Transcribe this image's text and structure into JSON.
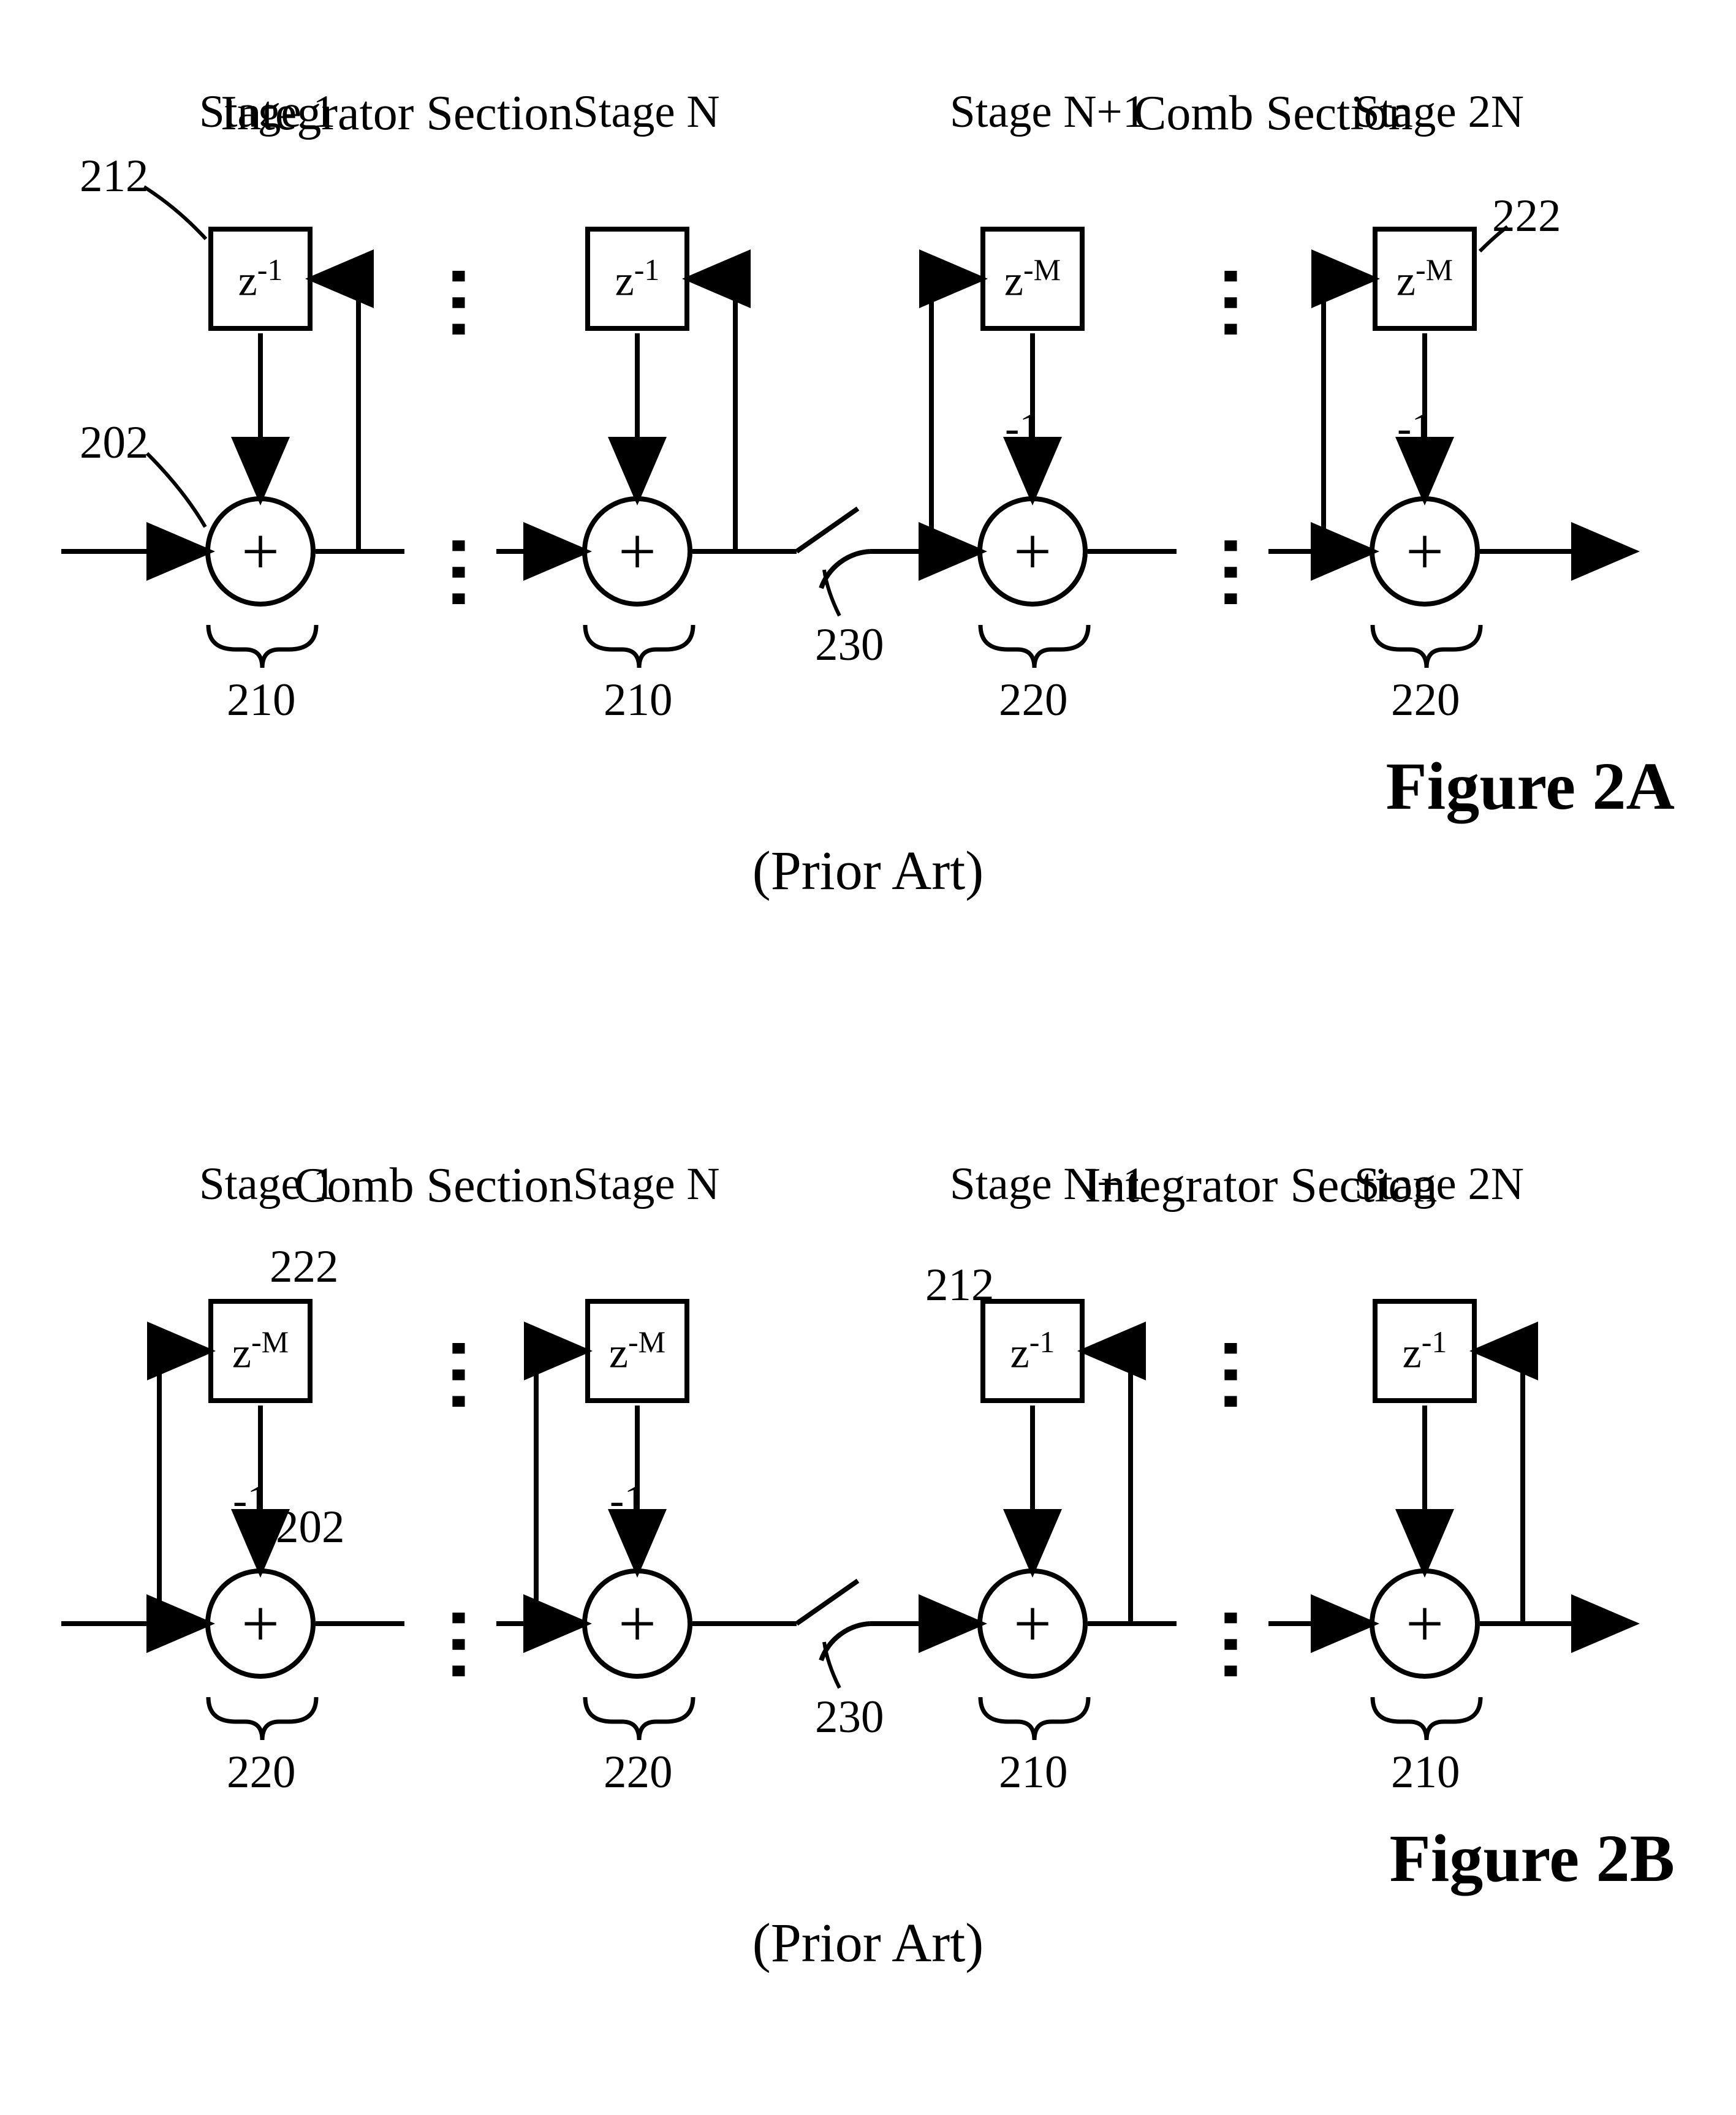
{
  "figA": {
    "sections": {
      "left": "Integrator Section",
      "right": "Comb Section"
    },
    "stages": {
      "s1": "Stage 1",
      "sN": "Stage N",
      "sNp1": "Stage N+1",
      "s2N": "Stage 2N"
    },
    "delays": {
      "integrator": "z",
      "integrator_exp": "-1",
      "comb": "z",
      "comb_exp": "-M"
    },
    "adder": "+",
    "minus": "-1",
    "refs": {
      "r212": "212",
      "r202": "202",
      "r210": "210",
      "r230": "230",
      "r220": "220",
      "r222": "222"
    },
    "title": "Figure 2A",
    "prior_art": "(Prior Art)"
  },
  "figB": {
    "sections": {
      "left": "Comb Section",
      "right": "Integrator Section"
    },
    "stages": {
      "s1": "Stage 1",
      "sN": "Stage N",
      "sNp1": "Stage N+1",
      "s2N": "Stage 2N"
    },
    "delays": {
      "integrator": "z",
      "integrator_exp": "-1",
      "comb": "z",
      "comb_exp": "-M"
    },
    "adder": "+",
    "minus": "-1",
    "refs": {
      "r212": "212",
      "r202": "202",
      "r210": "210",
      "r230": "230",
      "r220": "220",
      "r222": "222"
    },
    "title": "Figure 2B",
    "prior_art": "(Prior Art)"
  }
}
